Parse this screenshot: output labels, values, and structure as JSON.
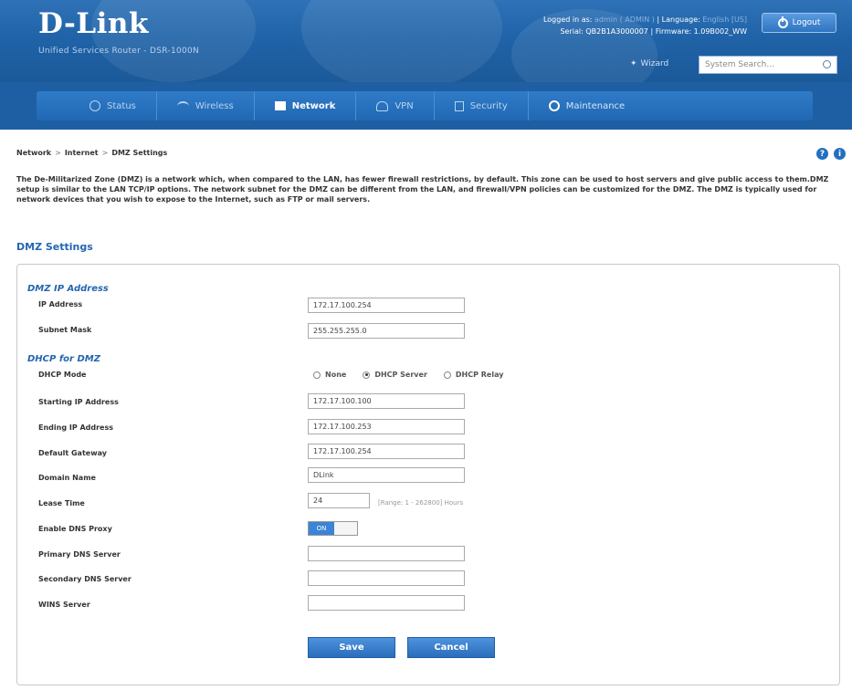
{
  "header": {
    "logo": "D-Link",
    "logo_sub": "Unified Services Router - DSR-1000N",
    "logged_in_label": "Logged in as:",
    "logged_in_user": "admin ( ADMIN )",
    "language_label": "Language:",
    "language_value": "English [US]",
    "serial_label": "Serial:",
    "serial_value": "QB2B1A3000007",
    "firmware_label": "Firmware:",
    "firmware_value": "1.09B002_WW",
    "logout": "Logout",
    "wizard": "Wizard",
    "search_placeholder": "System Search..."
  },
  "nav": {
    "items": [
      {
        "label": "Status",
        "icon": "status-icon",
        "active": false
      },
      {
        "label": "Wireless",
        "icon": "wifi-icon",
        "active": false
      },
      {
        "label": "Network",
        "icon": "network-icon",
        "active": true
      },
      {
        "label": "VPN",
        "icon": "vpn-icon",
        "active": false
      },
      {
        "label": "Security",
        "icon": "lock-icon",
        "active": false
      },
      {
        "label": "Maintenance",
        "icon": "gear-icon",
        "active": false
      }
    ]
  },
  "breadcrumb": {
    "items": [
      "Network",
      "Internet",
      "DMZ Settings"
    ],
    "separator": ">"
  },
  "description": "The De-Militarized Zone (DMZ) is a network which, when compared to the LAN, has fewer firewall restrictions, by default. This zone can be used to host servers and give public access to them.DMZ setup is similar to the LAN TCP/IP options. The network subnet for the DMZ can be different from the LAN, and firewall/VPN policies can be customized for the DMZ. The DMZ is typically used for network devices that you wish to expose to the Internet, such as FTP or mail servers.",
  "section_title": "DMZ Settings",
  "dmz_ip": {
    "title": "DMZ IP Address",
    "ip_label": "IP Address",
    "ip_value": "172.17.100.254",
    "mask_label": "Subnet Mask",
    "mask_value": "255.255.255.0"
  },
  "dhcp": {
    "title": "DHCP for DMZ",
    "mode_label": "DHCP Mode",
    "modes": [
      "None",
      "DHCP Server",
      "DHCP Relay"
    ],
    "selected_mode": "DHCP Server",
    "start_label": "Starting IP Address",
    "start_value": "172.17.100.100",
    "end_label": "Ending IP Address",
    "end_value": "172.17.100.253",
    "gateway_label": "Default Gateway",
    "gateway_value": "172.17.100.254",
    "domain_label": "Domain Name",
    "domain_value": "DLink",
    "lease_label": "Lease Time",
    "lease_value": "24",
    "lease_hint": "[Range: 1 - 262800] Hours",
    "dns_proxy_label": "Enable DNS Proxy",
    "dns_proxy_on": "ON",
    "primary_dns_label": "Primary DNS Server",
    "primary_dns_value": "",
    "secondary_dns_label": "Secondary DNS Server",
    "secondary_dns_value": "",
    "wins_label": "WINS Server",
    "wins_value": ""
  },
  "buttons": {
    "save": "Save",
    "cancel": "Cancel"
  },
  "colors": {
    "header_blue": "#2063a8",
    "accent": "#2466b0",
    "button_blue": "#3a80cf"
  }
}
